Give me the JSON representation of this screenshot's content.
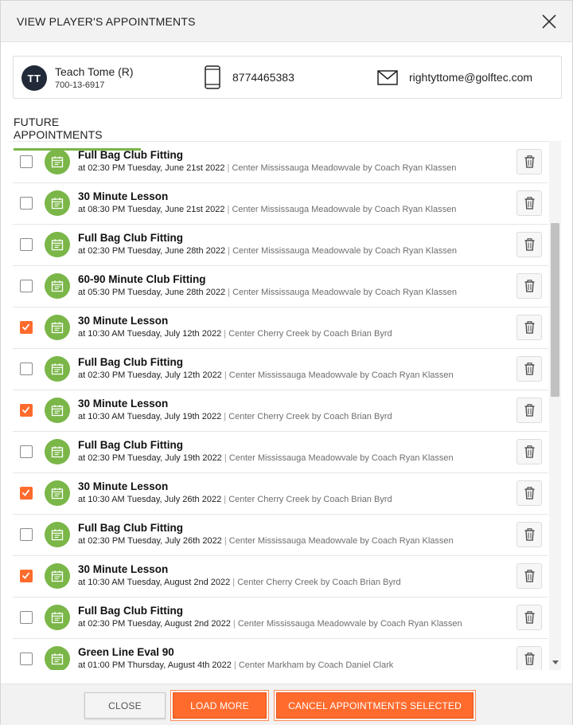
{
  "header": {
    "title": "VIEW PLAYER'S APPOINTMENTS"
  },
  "player": {
    "initials": "TT",
    "name": "Teach Tome (R)",
    "id": "700-13-6917",
    "phone": "8774465383",
    "email": "rightyttome@golftec.com"
  },
  "tab_label": "FUTURE APPOINTMENTS",
  "appointments": [
    {
      "title": "Full Bag Club Fitting",
      "time": "at 02:30 PM Tuesday, June 21st 2022",
      "sep": " | ",
      "location": "Center Mississauga Meadowvale by Coach Ryan Klassen",
      "checked": false
    },
    {
      "title": "30 Minute Lesson",
      "time": "at 08:30 PM Tuesday, June 21st 2022",
      "sep": " | ",
      "location": "Center Mississauga Meadowvale by Coach Ryan Klassen",
      "checked": false
    },
    {
      "title": "Full Bag Club Fitting",
      "time": "at 02:30 PM Tuesday, June 28th 2022",
      "sep": " | ",
      "location": "Center Mississauga Meadowvale by Coach Ryan Klassen",
      "checked": false
    },
    {
      "title": "60-90 Minute Club Fitting",
      "time": "at 05:30 PM Tuesday, June 28th 2022",
      "sep": " | ",
      "location": "Center Mississauga Meadowvale by Coach Ryan Klassen",
      "checked": false
    },
    {
      "title": "30 Minute Lesson",
      "time": "at 10:30 AM Tuesday, July 12th 2022",
      "sep": " | ",
      "location": "Center Cherry Creek by Coach Brian Byrd",
      "checked": true
    },
    {
      "title": "Full Bag Club Fitting",
      "time": "at 02:30 PM Tuesday, July 12th 2022",
      "sep": " | ",
      "location": "Center Mississauga Meadowvale by Coach Ryan Klassen",
      "checked": false
    },
    {
      "title": "30 Minute Lesson",
      "time": "at 10:30 AM Tuesday, July 19th 2022",
      "sep": " | ",
      "location": "Center Cherry Creek by Coach Brian Byrd",
      "checked": true
    },
    {
      "title": "Full Bag Club Fitting",
      "time": "at 02:30 PM Tuesday, July 19th 2022",
      "sep": " | ",
      "location": "Center Mississauga Meadowvale by Coach Ryan Klassen",
      "checked": false
    },
    {
      "title": "30 Minute Lesson",
      "time": "at 10:30 AM Tuesday, July 26th 2022",
      "sep": " | ",
      "location": "Center Cherry Creek by Coach Brian Byrd",
      "checked": true
    },
    {
      "title": "Full Bag Club Fitting",
      "time": "at 02:30 PM Tuesday, July 26th 2022",
      "sep": " | ",
      "location": "Center Mississauga Meadowvale by Coach Ryan Klassen",
      "checked": false
    },
    {
      "title": "30 Minute Lesson",
      "time": "at 10:30 AM Tuesday, August 2nd 2022",
      "sep": " | ",
      "location": "Center Cherry Creek by Coach Brian Byrd",
      "checked": true
    },
    {
      "title": "Full Bag Club Fitting",
      "time": "at 02:30 PM Tuesday, August 2nd 2022",
      "sep": " | ",
      "location": "Center Mississauga Meadowvale by Coach Ryan Klassen",
      "checked": false
    },
    {
      "title": "Green Line Eval 90",
      "time": "at 01:00 PM Thursday, August 4th 2022",
      "sep": " | ",
      "location": "Center Markham by Coach Daniel Clark",
      "checked": false
    }
  ],
  "footer": {
    "close_label": "CLOSE",
    "load_more_label": "LOAD MORE",
    "cancel_selected_label": "CANCEL APPOINTMENTS SELECTED"
  },
  "colors": {
    "accent_orange": "#ff6b2d",
    "accent_green": "#7ab648",
    "avatar_bg": "#222a3a"
  },
  "icons": {
    "close": "close-icon",
    "phone": "phone-icon",
    "email": "mail-icon",
    "calendar": "calendar-icon",
    "delete": "trash-icon",
    "checkmark": "checkmark-icon"
  }
}
